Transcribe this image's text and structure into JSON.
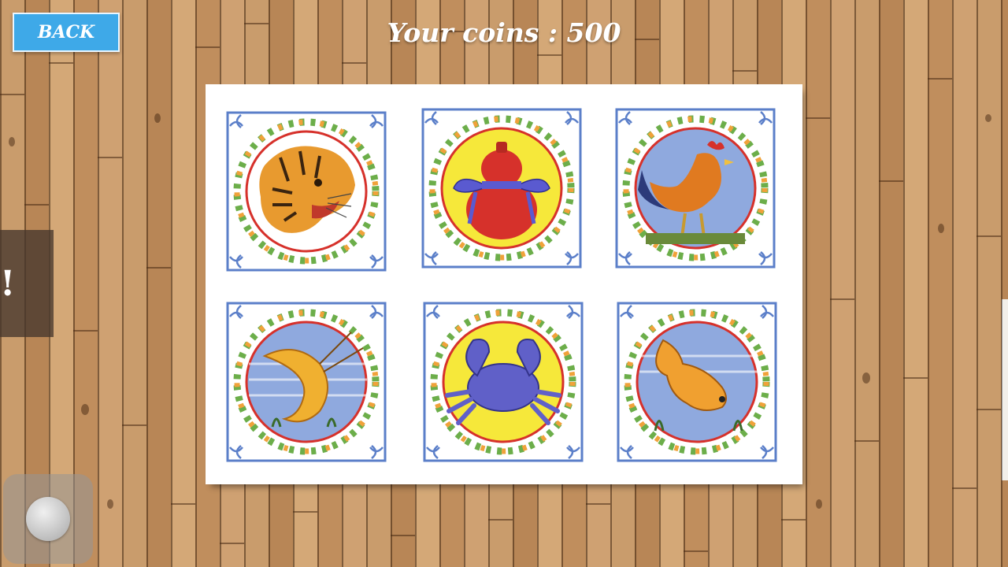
{
  "ui": {
    "back_label": "BACK",
    "coins_text": "Your coins : 500",
    "side_tab_text": "!"
  },
  "colors": {
    "back_button": "#3ea9e8",
    "board": "#ffffff",
    "tile_frame": "#5b7fc9",
    "wreath_leaf": "#6cae4a",
    "wreath_flower": "#f0a23a",
    "ring_red": "#d6312b"
  },
  "tiles": [
    {
      "name": "tiger",
      "icon": "tiger-icon",
      "bg": "#ffffff"
    },
    {
      "name": "gourd",
      "icon": "gourd-icon",
      "bg": "#f6e83a"
    },
    {
      "name": "rooster",
      "icon": "rooster-icon",
      "bg": "#8fa9de"
    },
    {
      "name": "shrimp",
      "icon": "shrimp-icon",
      "bg": "#8fa9de"
    },
    {
      "name": "crab",
      "icon": "crab-icon",
      "bg": "#f6e83a"
    },
    {
      "name": "fish",
      "icon": "fish-icon",
      "bg": "#8fa9de"
    }
  ]
}
